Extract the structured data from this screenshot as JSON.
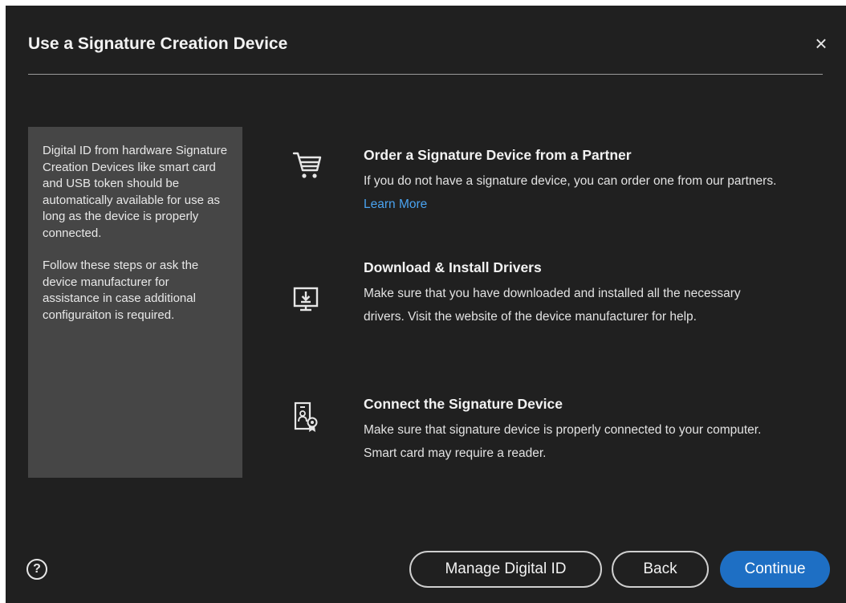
{
  "dialog": {
    "title": "Use a Signature Creation Device",
    "close_glyph": "×"
  },
  "info": {
    "paragraph1": "Digital ID from hardware Signature Creation Devices like smart card and USB token should be automatically available for use as long as the device is properly connected.",
    "paragraph2": "Follow these steps or ask the device manufacturer for assistance in case additional configuraiton is required."
  },
  "steps": [
    {
      "icon": "cart-icon",
      "heading": "Order a Signature Device from a Partner",
      "description": "If you do not have a signature device, you can order one from our partners.",
      "link": "Learn More"
    },
    {
      "icon": "download-monitor-icon",
      "heading": "Download & Install Drivers",
      "description": "Make sure that you have downloaded and installed all the necessary drivers. Visit the website of the device manufacturer for help."
    },
    {
      "icon": "certificate-device-icon",
      "heading": "Connect the Signature Device",
      "description": "Make sure that signature device is properly connected to your computer. Smart card may require a reader."
    }
  ],
  "footer": {
    "help_glyph": "?",
    "manage_label": "Manage Digital ID",
    "back_label": "Back",
    "continue_label": "Continue"
  },
  "colors": {
    "background": "#202020",
    "panel": "#464646",
    "accent": "#1e6fc4",
    "link": "#4aa3f0"
  }
}
